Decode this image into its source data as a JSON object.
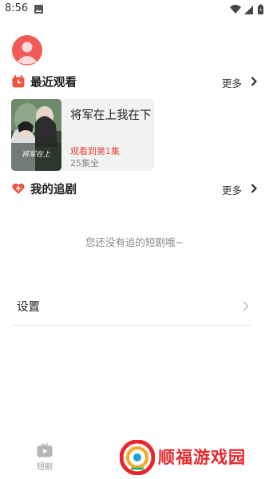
{
  "status_bar": {
    "time": "8:56"
  },
  "recent": {
    "title": "最近观看",
    "more_label": "更多",
    "items": [
      {
        "title": "将军在上我在下",
        "progress": "观看到第1集",
        "total": "25集全",
        "cover_caption": "将军在上"
      }
    ]
  },
  "following": {
    "title": "我的追剧",
    "more_label": "更多",
    "empty_text": "您还没有追的短剧哦~"
  },
  "settings": {
    "label": "设置"
  },
  "bottom_nav": {
    "tabs": [
      {
        "label": "短剧"
      }
    ]
  },
  "watermark": {
    "text": "顺福游戏园"
  },
  "colors": {
    "accent": "#e8453c",
    "card_bg": "#f2f2f3",
    "watermark": "#e8272c"
  }
}
